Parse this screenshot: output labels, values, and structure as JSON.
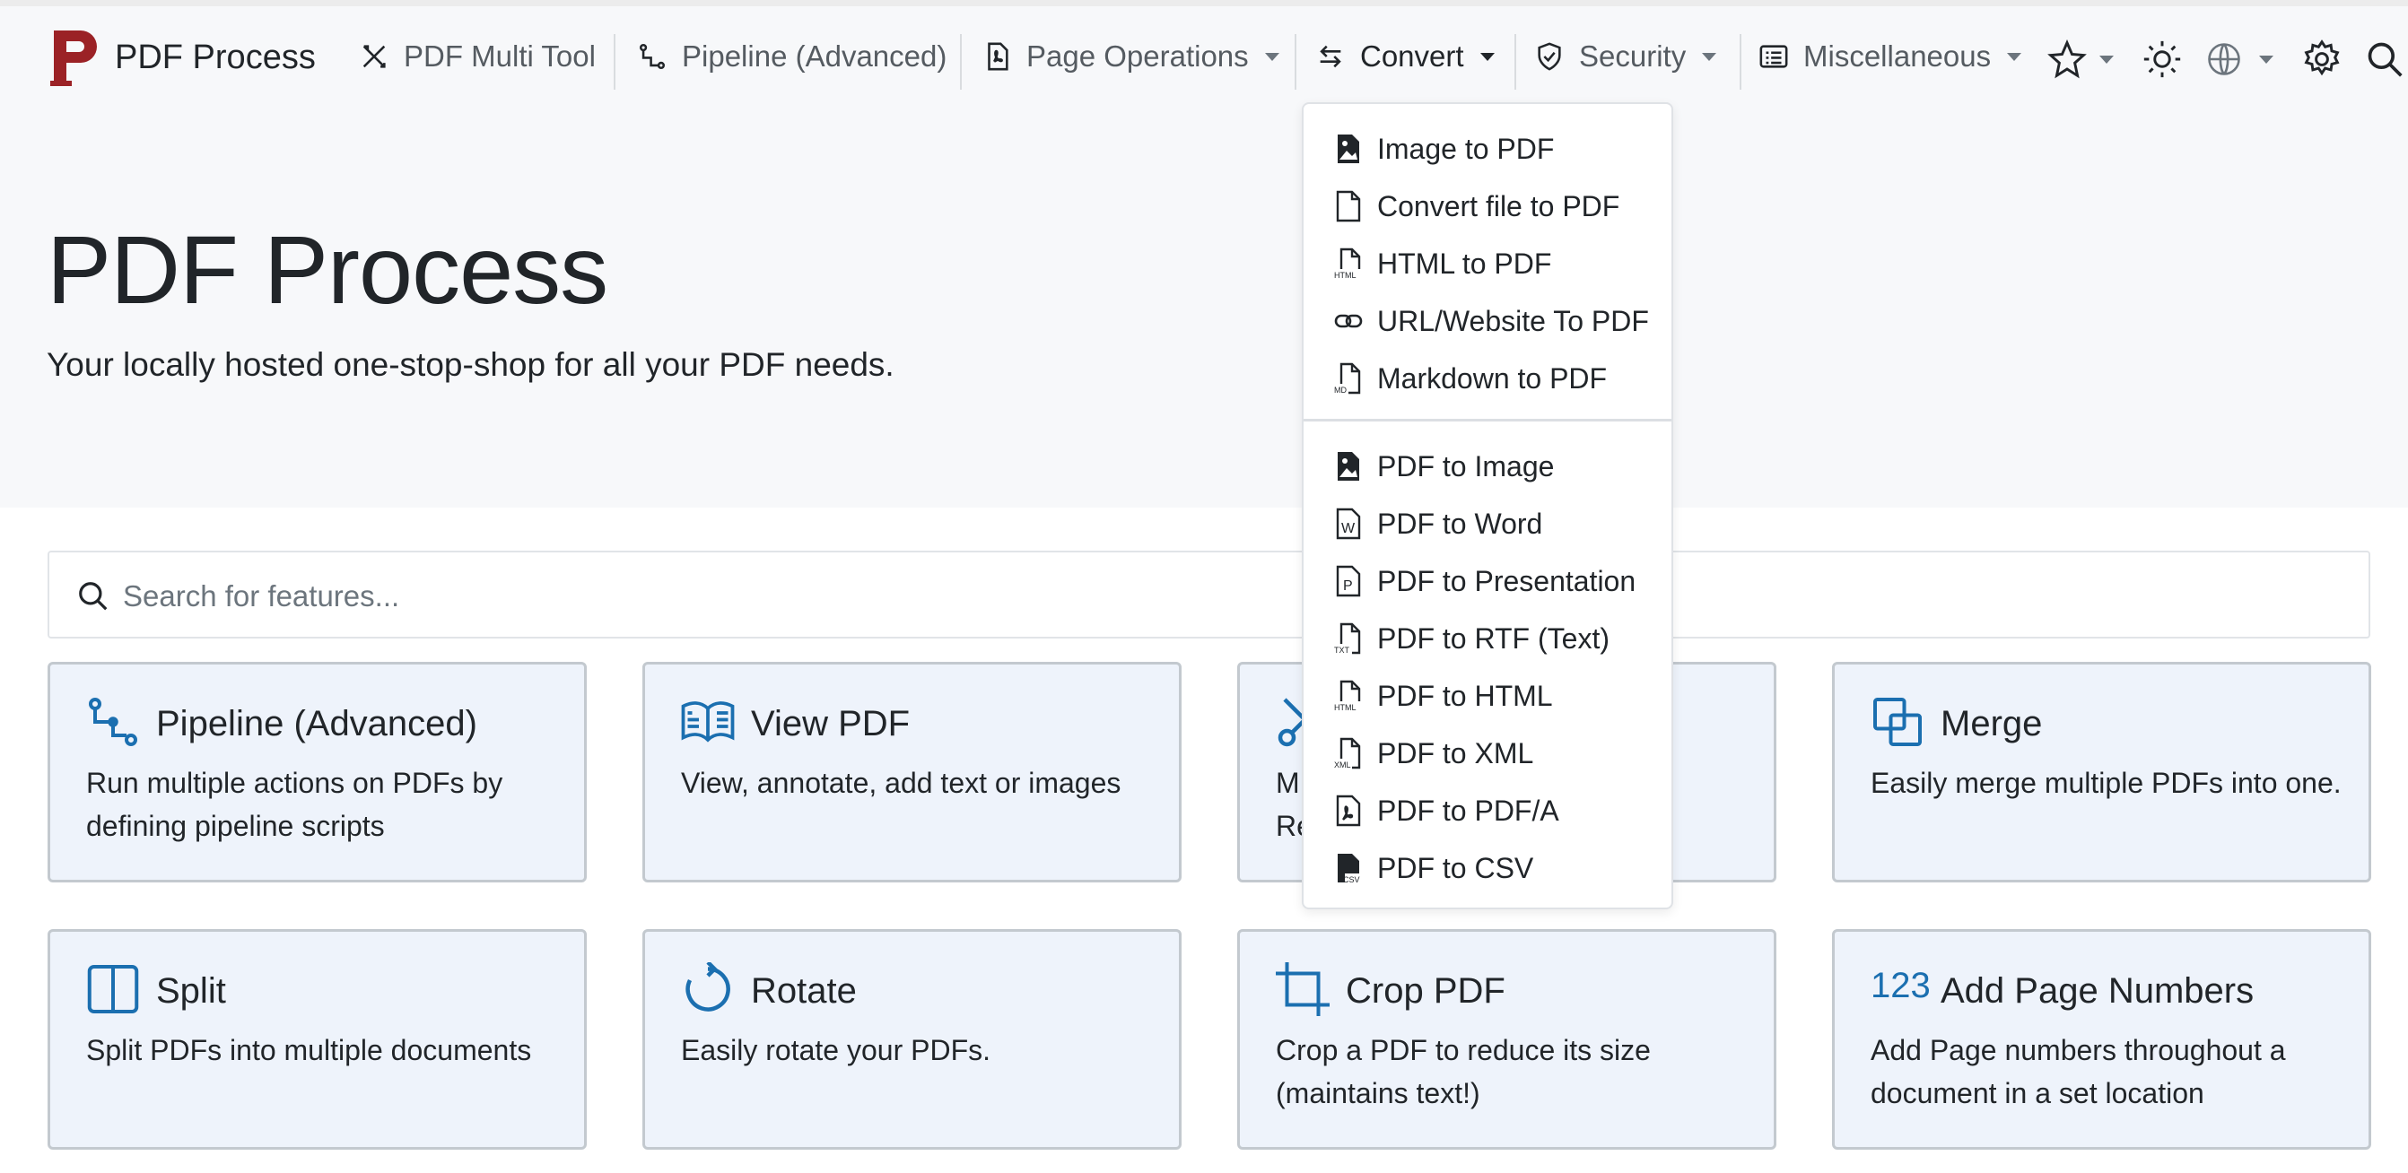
{
  "brand": {
    "name": "PDF Process",
    "logo_letter": "P"
  },
  "nav": {
    "multi_tool": "PDF Multi Tool",
    "pipeline": "Pipeline (Advanced)",
    "page_operations": "Page Operations",
    "convert": "Convert",
    "security": "Security",
    "miscellaneous": "Miscellaneous",
    "icons": [
      "star-icon",
      "sun-icon",
      "globe-icon",
      "gear-icon",
      "search-icon"
    ]
  },
  "hero": {
    "title": "PDF Process",
    "subtitle": "Your locally hosted one-stop-shop for all your PDF needs."
  },
  "search": {
    "placeholder": "Search for features..."
  },
  "convert_menu": {
    "to_pdf": [
      {
        "label": "Image to PDF",
        "icon": "image-file-icon"
      },
      {
        "label": "Convert file to PDF",
        "icon": "file-icon"
      },
      {
        "label": "HTML to PDF",
        "icon": "html-file-icon",
        "tag": "HTML"
      },
      {
        "label": "URL/Website To PDF",
        "icon": "link-icon"
      },
      {
        "label": "Markdown to PDF",
        "icon": "markdown-file-icon",
        "tag": "MD"
      }
    ],
    "from_pdf": [
      {
        "label": "PDF to Image",
        "icon": "image-file-icon"
      },
      {
        "label": "PDF to Word",
        "icon": "word-file-icon",
        "tag": "W"
      },
      {
        "label": "PDF to Presentation",
        "icon": "presentation-file-icon",
        "tag": "P"
      },
      {
        "label": "PDF to RTF (Text)",
        "icon": "txt-file-icon",
        "tag": "TXT"
      },
      {
        "label": "PDF to HTML",
        "icon": "html-file-icon",
        "tag": "HTML"
      },
      {
        "label": "PDF to XML",
        "icon": "xml-file-icon",
        "tag": "XML"
      },
      {
        "label": "PDF to PDF/A",
        "icon": "pdf-file-icon"
      },
      {
        "label": "PDF to CSV",
        "icon": "csv-file-icon",
        "tag": "CSV"
      }
    ]
  },
  "cards": [
    {
      "title": "Pipeline (Advanced)",
      "desc": "Run multiple actions on PDFs by defining pipeline scripts",
      "icon": "pipeline-icon"
    },
    {
      "title": "View PDF",
      "desc": "View, annotate, add text or images",
      "icon": "book-icon"
    },
    {
      "title": "",
      "desc": "M… Re…",
      "icon": "tools-icon"
    },
    {
      "title": "Merge",
      "desc": "Easily merge multiple PDFs into one.",
      "icon": "merge-icon"
    },
    {
      "title": "Split",
      "desc": "Split PDFs into multiple documents",
      "icon": "split-icon"
    },
    {
      "title": "Rotate",
      "desc": "Easily rotate your PDFs.",
      "icon": "rotate-icon"
    },
    {
      "title": "Crop PDF",
      "desc": "Crop a PDF to reduce its size (maintains text!)",
      "icon": "crop-icon"
    },
    {
      "title": "Add Page Numbers",
      "desc": "Add Page numbers throughout a document in a set location",
      "icon": "numbers-icon",
      "icon_text": "123"
    }
  ],
  "colors": {
    "accent": "#1b6fb0",
    "brand_red": "#9b2226",
    "card_bg": "#eef3fb",
    "hero_bg": "#f7f8fa"
  }
}
